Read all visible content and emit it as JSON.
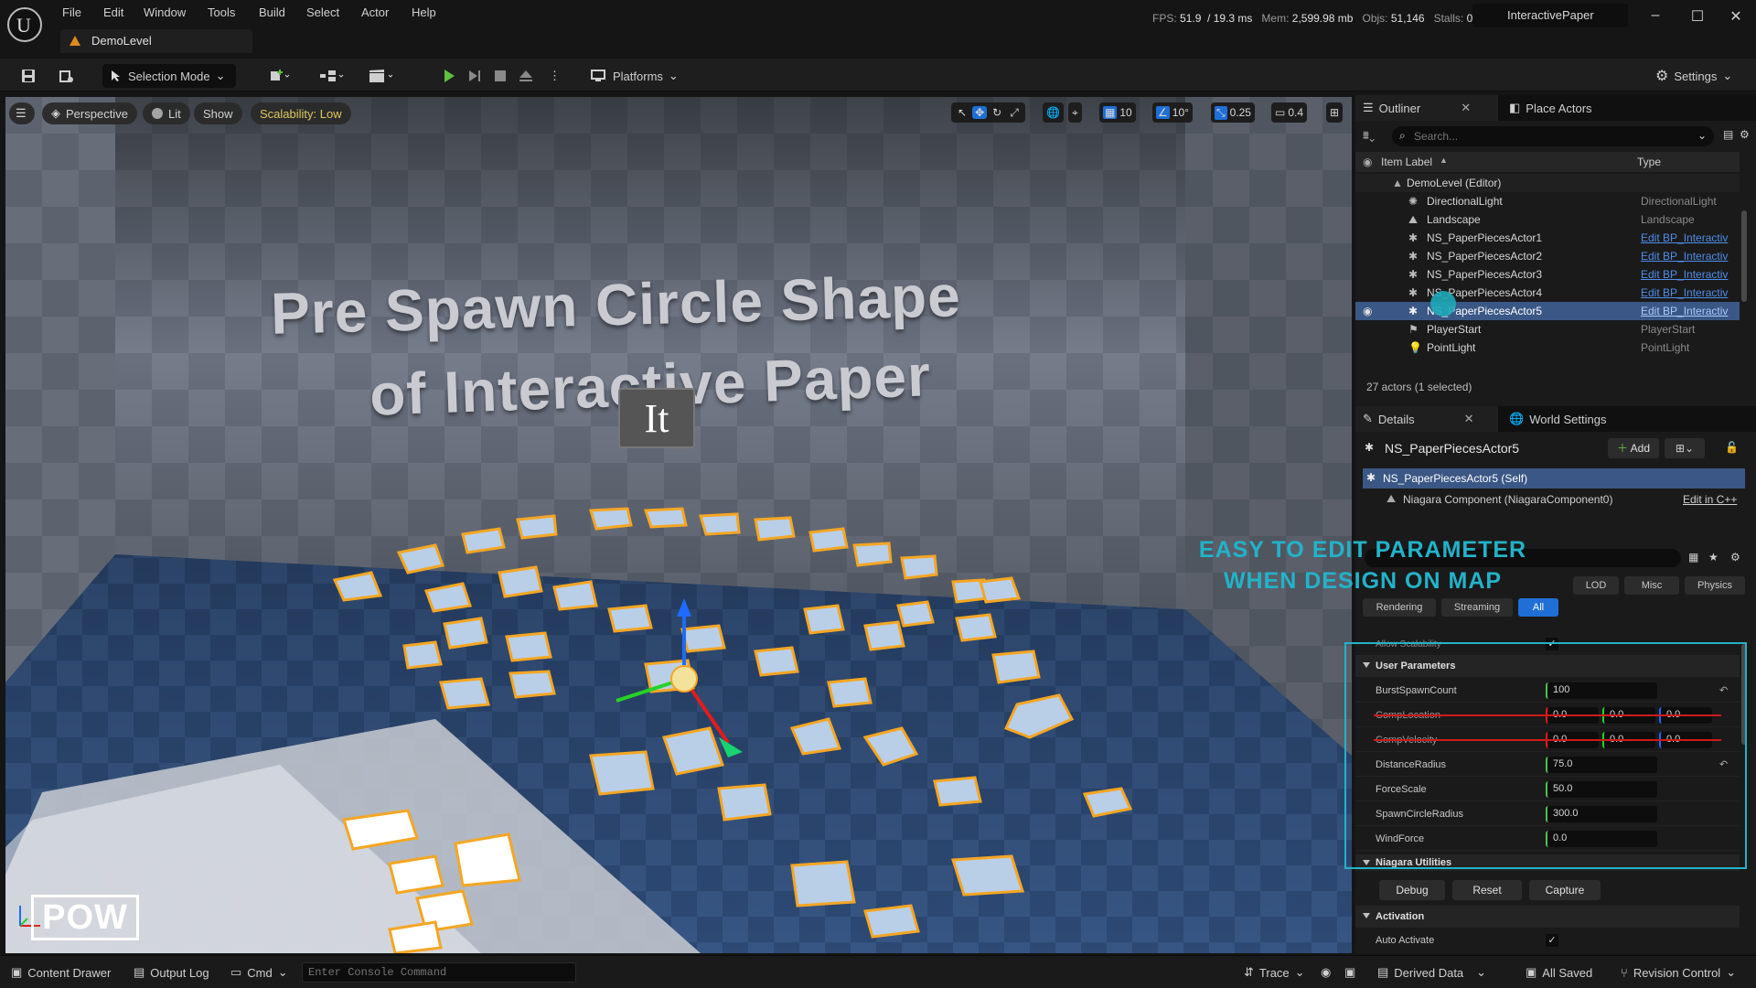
{
  "window": {
    "app": "InteractivePaper",
    "tab": "DemoLevel",
    "menu": [
      "File",
      "Edit",
      "Window",
      "Tools",
      "Build",
      "Select",
      "Actor",
      "Help"
    ],
    "stats": {
      "fps_label": "FPS:",
      "fps": "51.9",
      "ms": "/ 19.3 ms",
      "mem_label": "Mem:",
      "mem": "2,599.98 mb",
      "objs_label": "Objs:",
      "objs": "51,146",
      "stalls_label": "Stalls:",
      "stalls": "0"
    },
    "controls": {
      "minimize": "–",
      "maximize": "☐",
      "close": "✕"
    }
  },
  "toolbar": {
    "selection_mode": "Selection Mode",
    "platforms": "Platforms",
    "settings": "Settings"
  },
  "viewport": {
    "perspective": "Perspective",
    "lit": "Lit",
    "show": "Show",
    "scalability": "Scalability: Low",
    "grid_snap": "10",
    "rot_snap": "10°",
    "scale_snap": "0.25",
    "cam_speed": "0.4",
    "scene_title_line1": "Pre Spawn Circle Shape",
    "scene_title_line2": "of Interactive Paper",
    "scene_logo": "It",
    "watermark": "POW",
    "overlay_line1": "EASY TO EDIT PARAMETER",
    "overlay_line2": "WHEN DESIGN ON MAP"
  },
  "outliner": {
    "tab": "Outliner",
    "place_actors_tab": "Place Actors",
    "search_placeholder": "Search...",
    "col_label": "Item Label",
    "col_type": "Type",
    "root": "DemoLevel (Editor)",
    "rows": [
      {
        "label": "DirectionalLight",
        "type": "DirectionalLight",
        "link": false
      },
      {
        "label": "Landscape",
        "type": "Landscape",
        "link": false
      },
      {
        "label": "NS_PaperPiecesActor1",
        "type": "Edit BP_Interactiv",
        "link": true
      },
      {
        "label": "NS_PaperPiecesActor2",
        "type": "Edit BP_Interactiv",
        "link": true
      },
      {
        "label": "NS_PaperPiecesActor3",
        "type": "Edit BP_Interactiv",
        "link": true
      },
      {
        "label": "NS_PaperPiecesActor4",
        "type": "Edit BP_Interactiv",
        "link": true
      },
      {
        "label": "NS_PaperPiecesActor5",
        "type": "Edit BP_Interactiv",
        "link": true
      },
      {
        "label": "PlayerStart",
        "type": "PlayerStart",
        "link": false
      },
      {
        "label": "PointLight",
        "type": "PointLight",
        "link": false
      }
    ],
    "count": "27 actors (1 selected)"
  },
  "details": {
    "tab": "Details",
    "world_settings_tab": "World Settings",
    "actor_name": "NS_PaperPiecesActor5",
    "add_button": "Add",
    "self_row": "NS_PaperPiecesActor5 (Self)",
    "component_row": "Niagara Component (NiagaraComponent0)",
    "edit_cpp": "Edit in C++",
    "filters_row1": [
      "LOD",
      "Misc",
      "Physics"
    ],
    "filters_row2": [
      "Rendering",
      "Streaming",
      "All"
    ],
    "allow_scalability": "Allow Scalability",
    "user_params_header": "User Parameters",
    "params": [
      {
        "name": "BurstSpawnCount",
        "value": "100",
        "strike": false
      },
      {
        "name": "CompLocation",
        "value": "0.0",
        "strike": true
      },
      {
        "name": "CompVelocity",
        "value": "0.0",
        "strike": true
      },
      {
        "name": "DistanceRadius",
        "value": "75.0",
        "strike": false
      },
      {
        "name": "ForceScale",
        "value": "50.0",
        "strike": false
      },
      {
        "name": "SpawnCircleRadius",
        "value": "300.0",
        "strike": false
      },
      {
        "name": "WindForce",
        "value": "0.0",
        "strike": false
      }
    ],
    "niagara_utilities_header": "Niagara Utilities",
    "util_buttons": [
      "Debug",
      "Reset",
      "Capture"
    ],
    "activation_header": "Activation",
    "auto_activate": "Auto Activate"
  },
  "statusbar": {
    "content_drawer": "Content Drawer",
    "output_log": "Output Log",
    "cmd": "Cmd",
    "console_placeholder": "Enter Console Command",
    "trace": "Trace",
    "derived_data": "Derived Data",
    "all_saved": "All Saved",
    "revision_control": "Revision Control"
  },
  "colors": {
    "accent_blue": "#1f6fd6",
    "highlight_cyan": "#22b3c9",
    "selection_orange": "#f5a623",
    "play_green": "#5fbf3f"
  }
}
